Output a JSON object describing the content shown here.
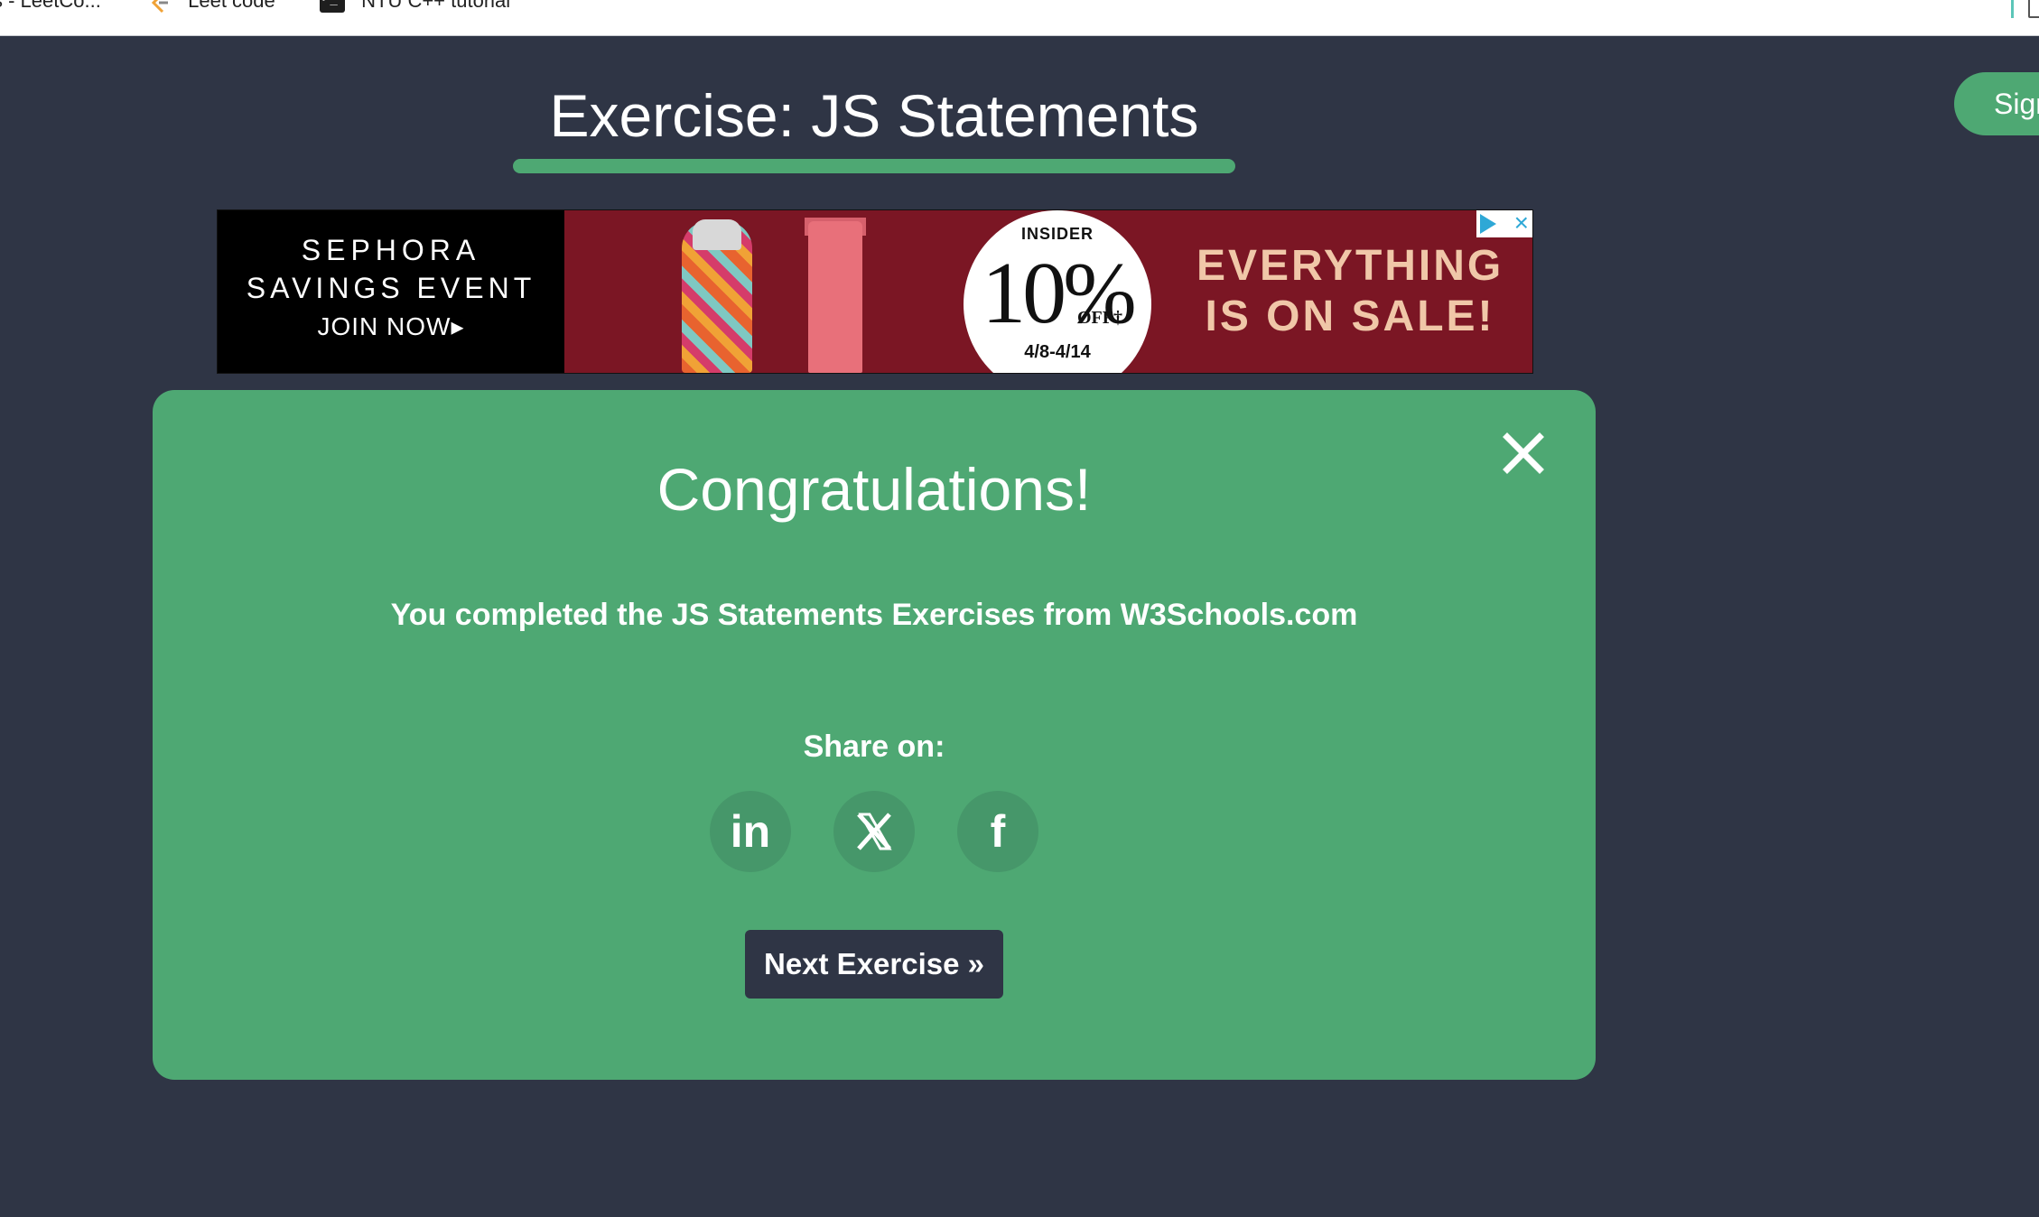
{
  "bookmarks": {
    "items": [
      {
        "label": "s - LeetCo...",
        "icon": "leetcode-icon"
      },
      {
        "label": "Leet code",
        "icon": "leetcode-icon"
      },
      {
        "label": "NTU C++ tutorial",
        "icon": "terminal-icon"
      }
    ]
  },
  "header": {
    "title": "Exercise: JS Statements",
    "signin_label": "Sign in"
  },
  "ad": {
    "brand": "SEPHORA",
    "event": "SAVINGS EVENT",
    "cta": "JOIN NOW▸",
    "badge_top": "INSIDER",
    "badge_percent": "10%",
    "badge_off": "OFF†",
    "badge_dates": "4/8-4/14",
    "headline_line1": "EVERYTHING",
    "headline_line2": "IS ON SALE!",
    "choices_icon": "ad-choices-icon"
  },
  "modal": {
    "title": "Congratulations!",
    "message": "You completed the JS Statements Exercises from W3Schools.com",
    "share_label": "Share on:",
    "share": [
      {
        "name": "LinkedIn",
        "glyph": "in"
      },
      {
        "name": "X",
        "glyph": "𝕏"
      },
      {
        "name": "Facebook",
        "glyph": "f"
      }
    ],
    "next_label": "Next Exercise »"
  },
  "colors": {
    "background": "#2f3545",
    "accent": "#4ea873",
    "share_button": "#46976a",
    "ad_red": "#7b1624"
  }
}
